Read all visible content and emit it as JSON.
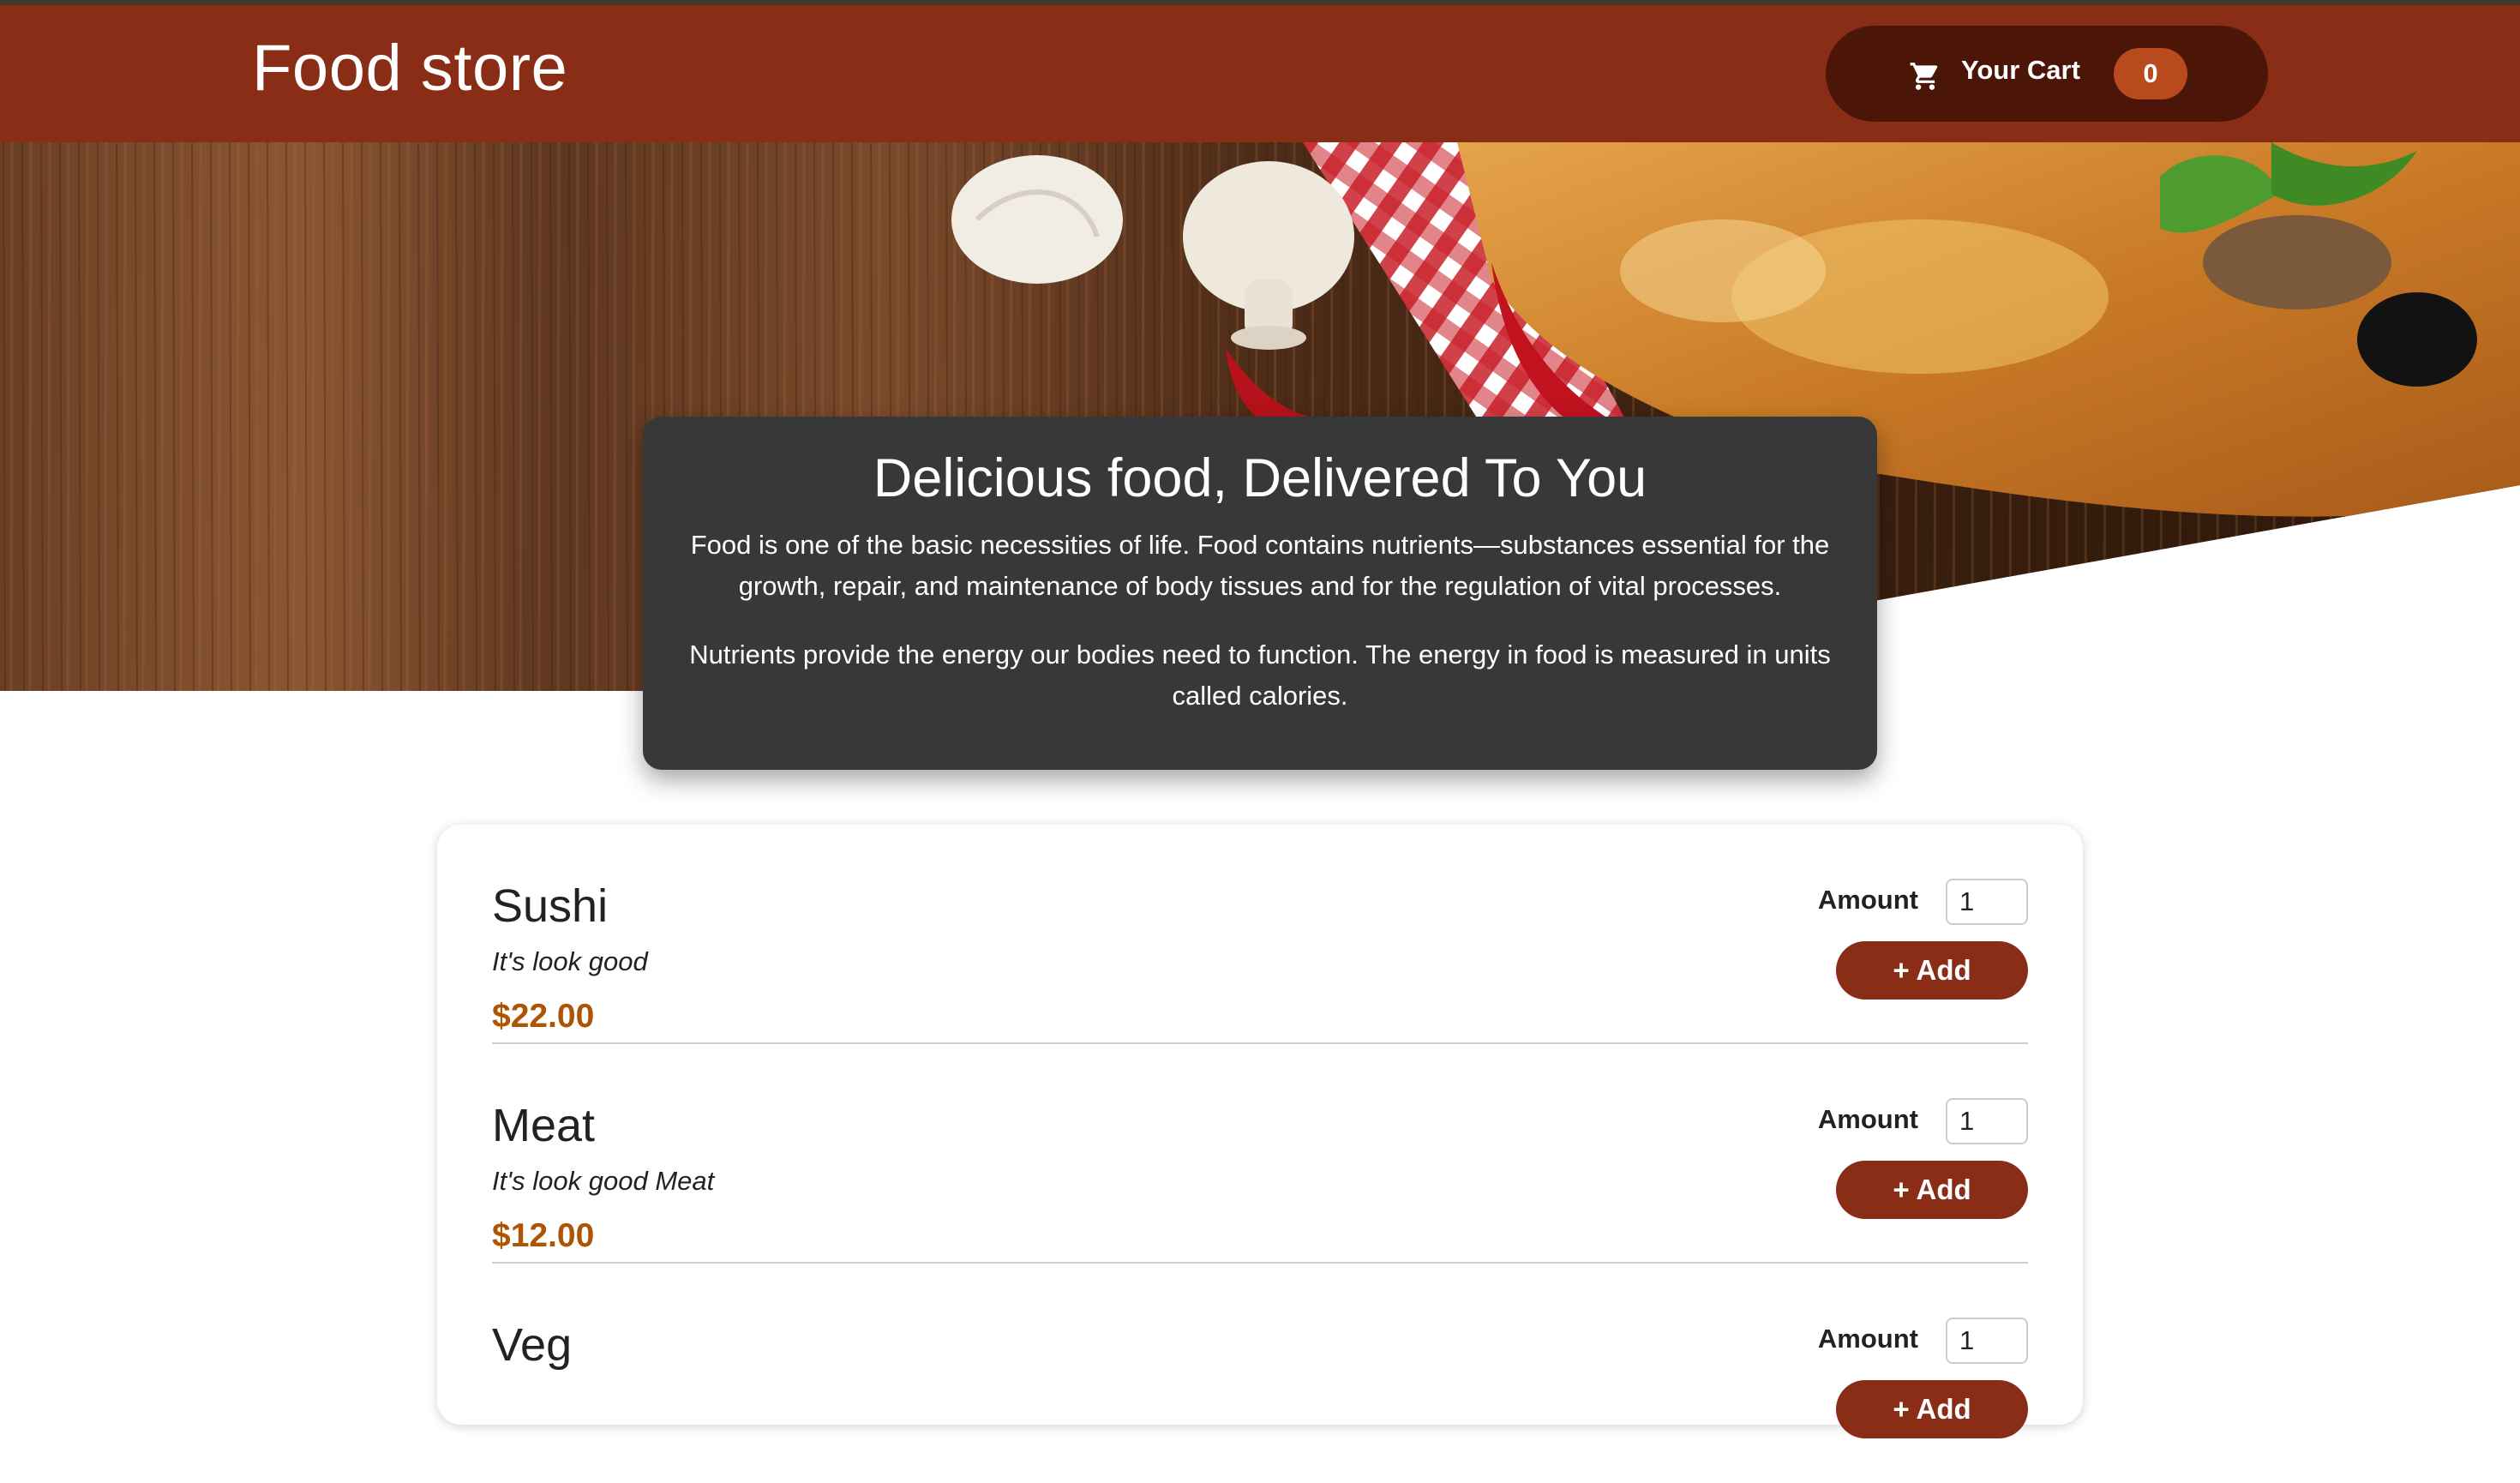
{
  "header": {
    "brand": "Food store",
    "cart_label": "Your Cart",
    "cart_count": "0",
    "cart_icon": "cart-icon"
  },
  "summary": {
    "title": "Delicious food, Delivered To You",
    "paragraph1": "Food is one of the basic necessities of life. Food contains nutrients—substances essential for the growth, repair, and maintenance of body tissues and for the regulation of vital processes.",
    "paragraph2": "Nutrients provide the energy our bodies need to function. The energy in food is measured in units called calories."
  },
  "meals": [
    {
      "name": "Sushi",
      "description": "It's look good",
      "price": "$22.00",
      "amount_label": "Amount",
      "amount": "1",
      "add_label": "+ Add"
    },
    {
      "name": "Meat",
      "description": "It's look good Meat",
      "price": "$12.00",
      "amount_label": "Amount",
      "amount": "1",
      "add_label": "+ Add"
    },
    {
      "name": "Veg",
      "description": "",
      "price": "",
      "amount_label": "Amount",
      "amount": "1",
      "add_label": "+ Add"
    }
  ],
  "colors": {
    "header_bg": "#8a2d16",
    "cart_bg": "#4b1508",
    "badge_bg": "#b84a1d",
    "price": "#ad5502",
    "summary_bg": "#383838"
  }
}
